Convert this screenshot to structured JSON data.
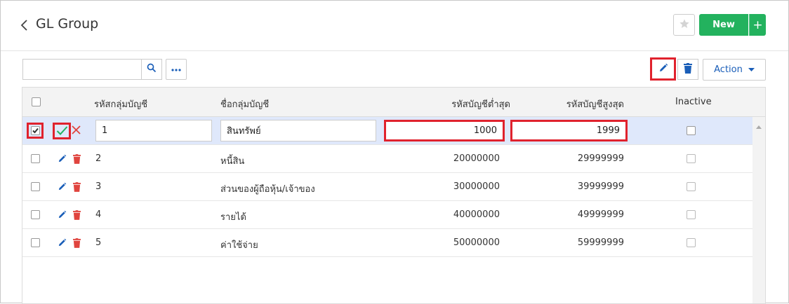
{
  "header": {
    "title": "GL Group",
    "new_label": "New",
    "plus_label": "+"
  },
  "toolbar": {
    "search_placeholder": "",
    "action_label": "Action"
  },
  "table": {
    "columns": {
      "code": "รหัสกลุ่มบัญชี",
      "name": "ชื่อกลุ่มบัญชี",
      "min": "รหัสบัญชีต่ำสุด",
      "max": "รหัสบัญชีสูงสุด",
      "inactive": "Inactive"
    },
    "editing_row": {
      "code": "1",
      "name": "สินทรัพย์",
      "min": "1000",
      "max": "1999",
      "selected": true
    },
    "rows": [
      {
        "code": "2",
        "name": "หนี้สิน",
        "min": "20000000",
        "max": "29999999"
      },
      {
        "code": "3",
        "name": "ส่วนของผู้ถือหุ้น/เจ้าของ",
        "min": "30000000",
        "max": "39999999"
      },
      {
        "code": "4",
        "name": "รายได้",
        "min": "40000000",
        "max": "49999999"
      },
      {
        "code": "5",
        "name": "ค่าใช้จ่าย",
        "min": "50000000",
        "max": "59999999"
      }
    ]
  },
  "colors": {
    "accent_green": "#23b25e",
    "link_blue": "#1a5eb8",
    "delete_red": "#e0443e",
    "highlight_red": "#e0222d",
    "selected_row": "#dfe8fb"
  }
}
